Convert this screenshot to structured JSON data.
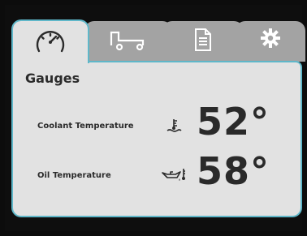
{
  "tabs": [
    {
      "name": "gauges",
      "icon": "speedometer-icon",
      "active": true
    },
    {
      "name": "vehicle",
      "icon": "truck-icon",
      "active": false
    },
    {
      "name": "document",
      "icon": "document-icon",
      "active": false
    },
    {
      "name": "settings",
      "icon": "gear-icon",
      "active": false
    }
  ],
  "panel": {
    "title": "Gauges",
    "rows": [
      {
        "label": "Coolant Temperature",
        "icon": "coolant-temperature-icon",
        "value": "52°"
      },
      {
        "label": "Oil Temperature",
        "icon": "oil-temperature-icon",
        "value": "58°"
      }
    ]
  },
  "colors": {
    "accent": "#5fb7c9",
    "panel_bg": "#e2e2e2",
    "tab_inactive": "#a3a3a3",
    "text": "#2b2b2b",
    "background": "#0c0c0c"
  }
}
